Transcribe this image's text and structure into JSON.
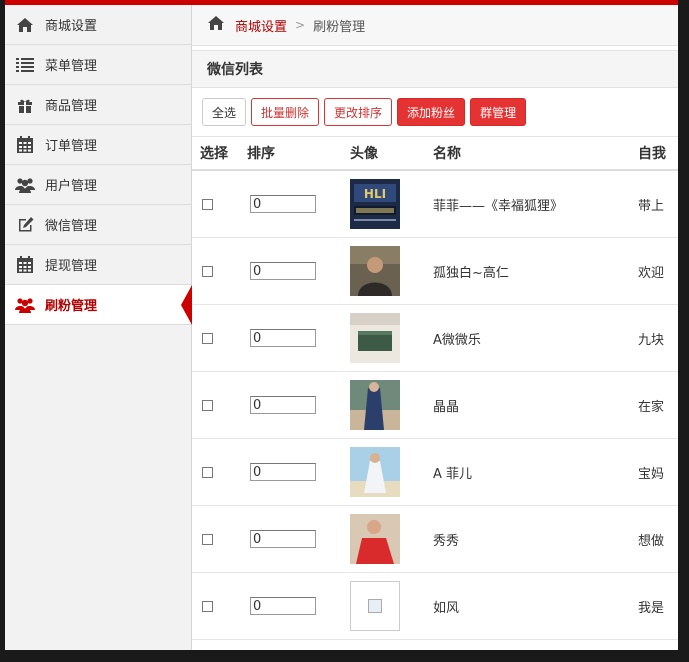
{
  "sidebar": {
    "items": [
      {
        "label": "商城设置",
        "icon": "home-icon"
      },
      {
        "label": "菜单管理",
        "icon": "list-icon"
      },
      {
        "label": "商品管理",
        "icon": "gift-icon"
      },
      {
        "label": "订单管理",
        "icon": "calendar-icon"
      },
      {
        "label": "用户管理",
        "icon": "users-icon"
      },
      {
        "label": "微信管理",
        "icon": "edit-icon"
      },
      {
        "label": "提现管理",
        "icon": "calendar-icon"
      },
      {
        "label": "刷粉管理",
        "icon": "users-icon",
        "active": true
      }
    ]
  },
  "breadcrumb": {
    "home_icon": "home-icon",
    "level1": "商城设置",
    "separator": ">",
    "level2": "刷粉管理"
  },
  "panel": {
    "title": "微信列表"
  },
  "toolbar": {
    "select_all": "全选",
    "batch_delete": "批量删除",
    "change_sort": "更改排序",
    "add_fans": "添加粉丝",
    "group_manage": "群管理"
  },
  "table": {
    "headers": {
      "select": "选择",
      "sort": "排序",
      "avatar": "头像",
      "name": "名称",
      "intro": "自我"
    },
    "rows": [
      {
        "sort": "0",
        "name": "菲菲——《幸福狐狸》",
        "intro": "带上",
        "avatar": "logo-dark"
      },
      {
        "sort": "0",
        "name": "孤独白~高仁",
        "intro": "欢迎",
        "avatar": "man-portrait"
      },
      {
        "sort": "0",
        "name": "A微微乐",
        "intro": "九块",
        "avatar": "green-box"
      },
      {
        "sort": "0",
        "name": "晶晶",
        "intro": "在家",
        "avatar": "woman-blue"
      },
      {
        "sort": "0",
        "name": "A 菲儿",
        "intro": "宝妈",
        "avatar": "woman-beach"
      },
      {
        "sort": "0",
        "name": "秀秀",
        "intro": "想做",
        "avatar": "woman-red"
      },
      {
        "sort": "0",
        "name": "如风",
        "intro": "我是",
        "avatar": "broken"
      }
    ]
  },
  "colors": {
    "accent": "#cc0000",
    "button_red": "#e53333",
    "link_red": "#b30000"
  }
}
